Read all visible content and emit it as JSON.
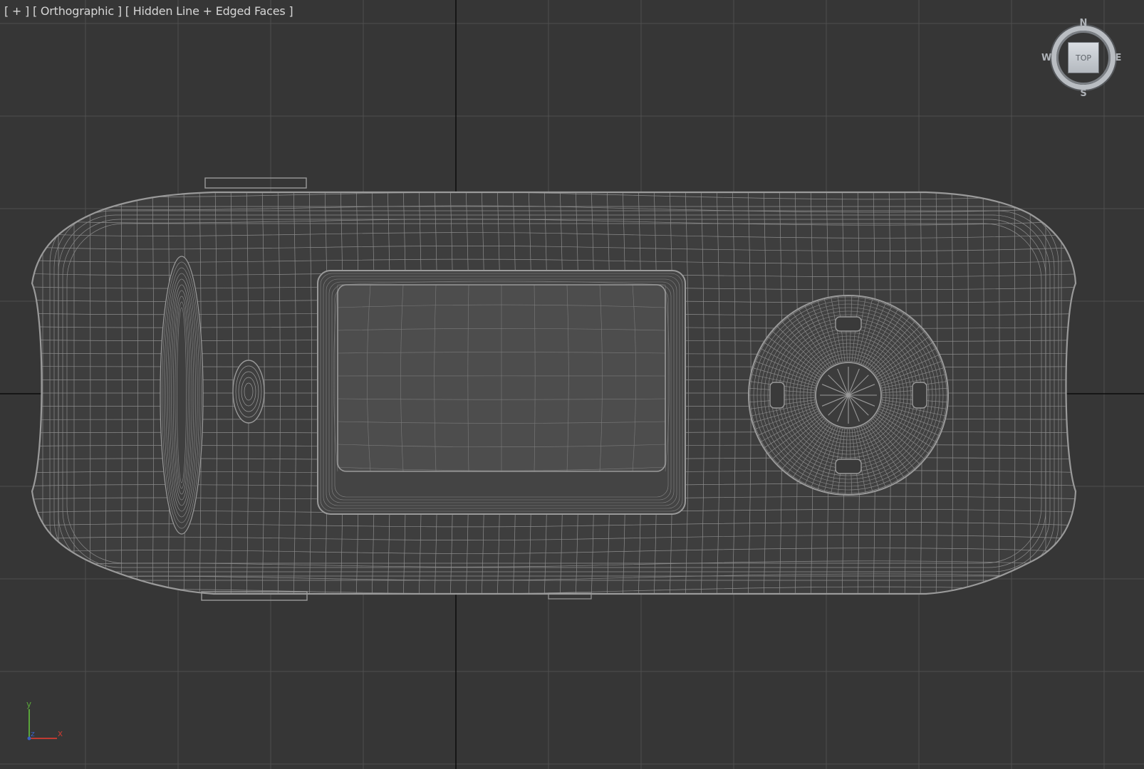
{
  "viewport": {
    "label": {
      "plus": "[ + ]",
      "view": "[ Orthographic ]",
      "shading": "[ Hidden Line + Edged Faces ]"
    },
    "viewcube": {
      "face": "TOP",
      "north": "N",
      "south": "S",
      "east": "E",
      "west": "W"
    },
    "axis": {
      "x": "x",
      "y": "y",
      "z": "z"
    },
    "colors": {
      "background": "#363636",
      "grid": "#4f4f4f",
      "home_grid_axis": "#0c0c0c",
      "wire": "#9a9a9a",
      "model_fill": "#3e3e3e",
      "screen_fill": "#4d4d4d",
      "axis_x": "#c13b32",
      "axis_y": "#5aa53a",
      "axis_z": "#3a5fc1"
    },
    "model": "mp3-player-wireframe"
  }
}
